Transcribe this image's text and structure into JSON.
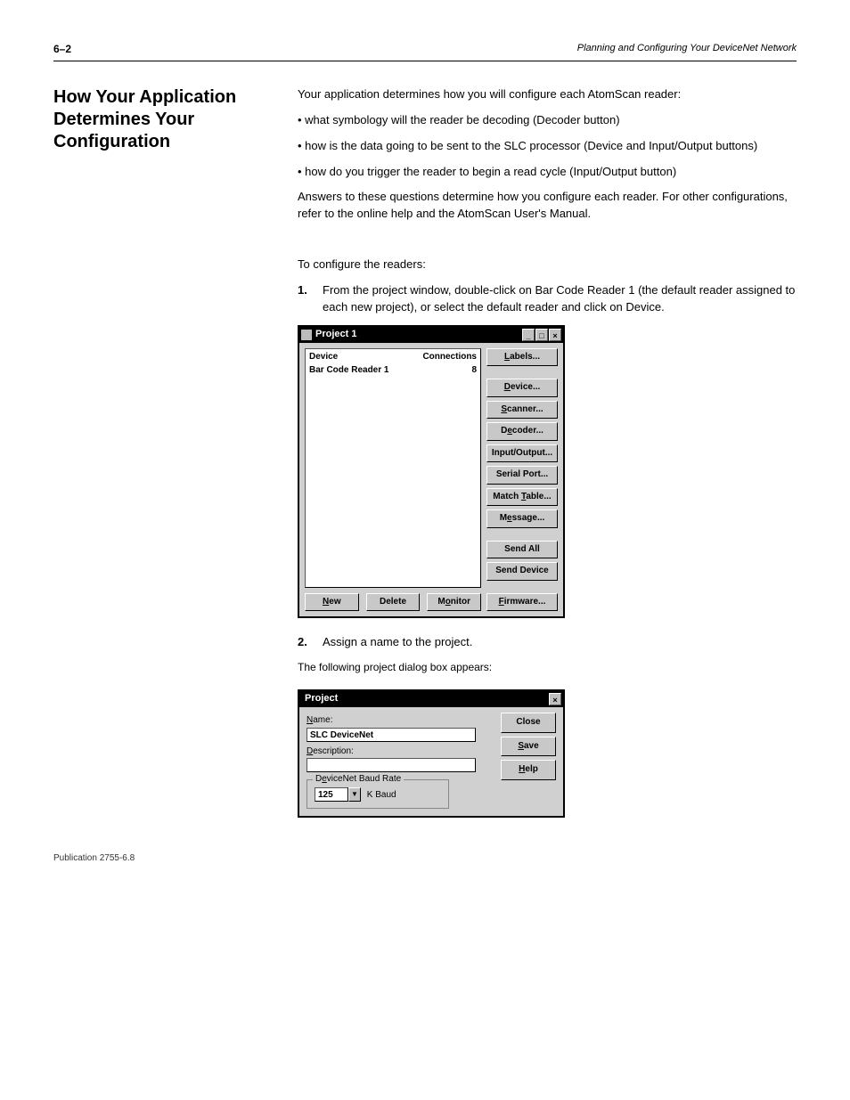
{
  "header": {
    "page_left": "6–2",
    "chapter": "Planning and Configuring Your DeviceNet Network"
  },
  "section": {
    "title": "How Your Application",
    "subtitle": "Determines Your Configuration"
  },
  "intro": {
    "p1": "Your application determines how you will configure each AtomScan reader:",
    "b1": "what symbology will the reader be decoding (Decoder button)",
    "b2": "how is the data going to be sent to the SLC processor (Device and Input/Output buttons)",
    "b3": "how do you trigger the reader to begin a read cycle (Input/Output button)",
    "p2": "Answers to these questions determine how you configure each reader. For other configurations, refer to the online help and the AtomScan User's Manual."
  },
  "config_sentence": "To configure the readers:",
  "steps": {
    "s1": "From the project window, double-click on Bar Code Reader 1 (the default reader assigned to each new project), or select the default reader and click on Device.",
    "s2": "Assign a name to the project."
  },
  "project_window": {
    "title": "Project 1",
    "list_header_device": "Device",
    "list_header_conn": "Connections",
    "row_device": "Bar Code Reader 1",
    "row_conn": "8",
    "btn_new": "New",
    "btn_delete": "Delete",
    "btn_monitor": "Monitor",
    "side": {
      "labels": "Labels...",
      "device": "Device...",
      "scanner": "Scanner...",
      "decoder": "Decoder...",
      "io": "Input/Output...",
      "serial": "Serial Port...",
      "match": "Match Table...",
      "message": "Message...",
      "sendall": "Send All",
      "senddev": "Send Device",
      "firmware": "Firmware..."
    }
  },
  "project_note": "The following project dialog box appears:",
  "project_dialog": {
    "title": "Project",
    "name_label": "Name:",
    "name_value": "SLC DeviceNet",
    "desc_label": "Description:",
    "desc_value": "",
    "group_label": "DeviceNet Baud Rate",
    "baud_value": "125",
    "baud_suffix": "K Baud",
    "btn_close": "Close",
    "btn_save": "Save",
    "btn_help": "Help"
  },
  "footer": {
    "pub": "Publication 2755-6.8"
  }
}
